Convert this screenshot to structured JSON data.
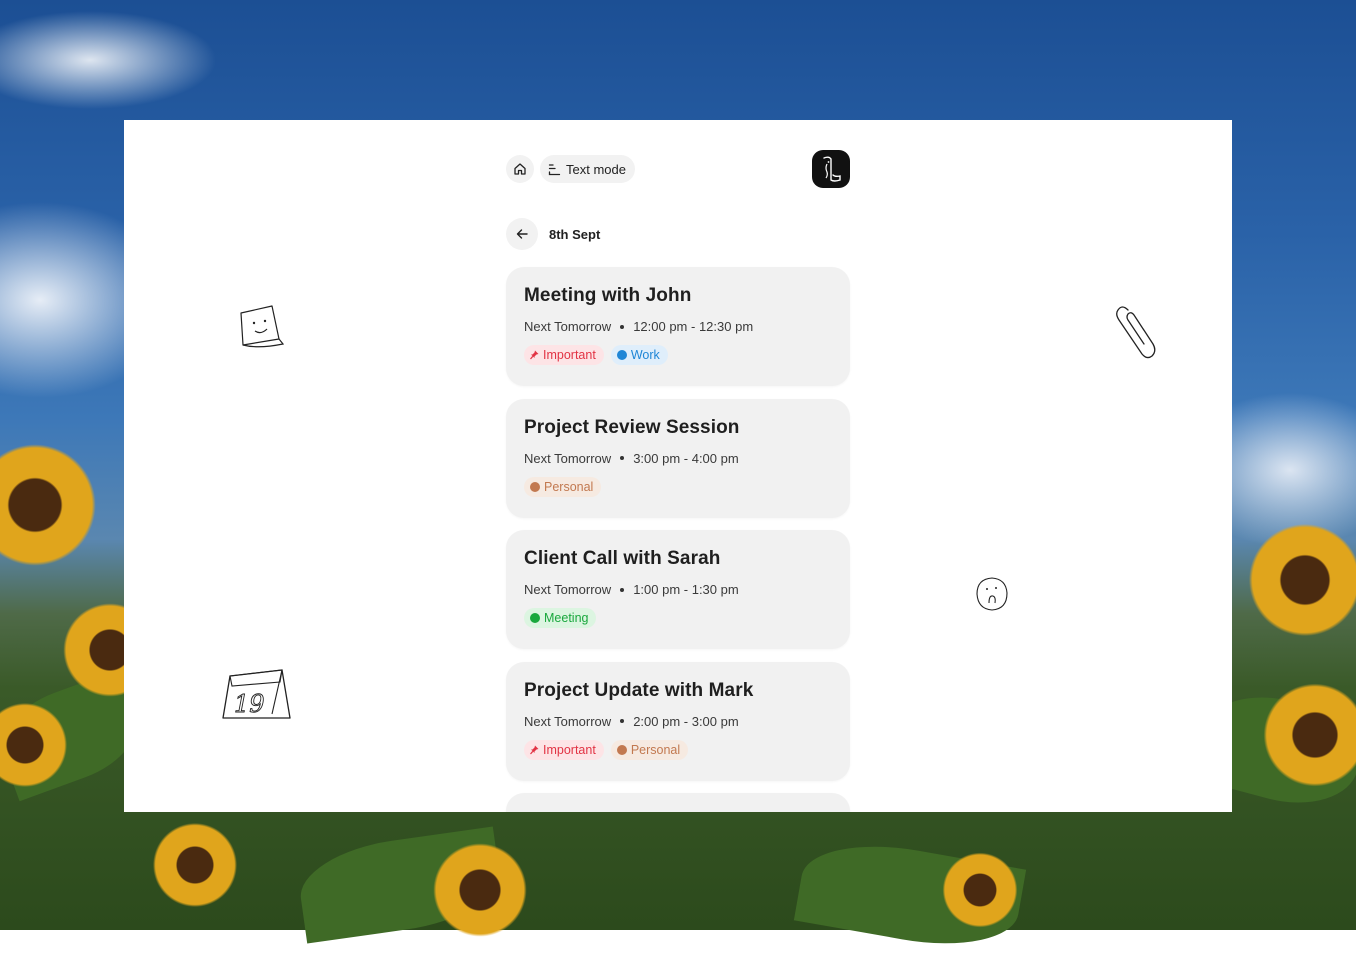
{
  "topbar": {
    "text_mode_label": "Text mode",
    "home_icon": "home-icon",
    "text_mode_icon": "text-lines-icon",
    "logo_icon": "app-logo-icon"
  },
  "datebar": {
    "back_icon": "arrow-left-icon",
    "date": "8th Sept"
  },
  "tag_colors": {
    "Important": "#e23344",
    "Work": "#1f86d6",
    "Personal": "#c27950",
    "Meeting": "#19a83d"
  },
  "events": [
    {
      "title": "Meeting with John",
      "day": "Next Tomorrow",
      "time": "12:00 pm - 12:30 pm",
      "tags": [
        {
          "label": "Important",
          "kind": "important",
          "icon": "pin-icon"
        },
        {
          "label": "Work",
          "kind": "work"
        }
      ]
    },
    {
      "title": "Project Review Session",
      "day": "Next Tomorrow",
      "time": "3:00 pm - 4:00 pm",
      "tags": [
        {
          "label": "Personal",
          "kind": "personal"
        }
      ]
    },
    {
      "title": "Client Call with Sarah",
      "day": "Next Tomorrow",
      "time": "1:00 pm - 1:30 pm",
      "tags": [
        {
          "label": "Meeting",
          "kind": "meeting"
        }
      ]
    },
    {
      "title": "Project Update with Mark",
      "day": "Next Tomorrow",
      "time": "2:00 pm - 3:00 pm",
      "tags": [
        {
          "label": "Important",
          "kind": "important",
          "icon": "pin-icon"
        },
        {
          "label": "Personal",
          "kind": "personal"
        }
      ]
    }
  ],
  "doodles": {
    "sticky_note": "sticky-note-doodle-icon",
    "paperclip": "paperclip-doodle-icon",
    "calendar": "calendar-doodle-icon",
    "calendar_number": "19",
    "face": "surprised-face-doodle-icon"
  }
}
